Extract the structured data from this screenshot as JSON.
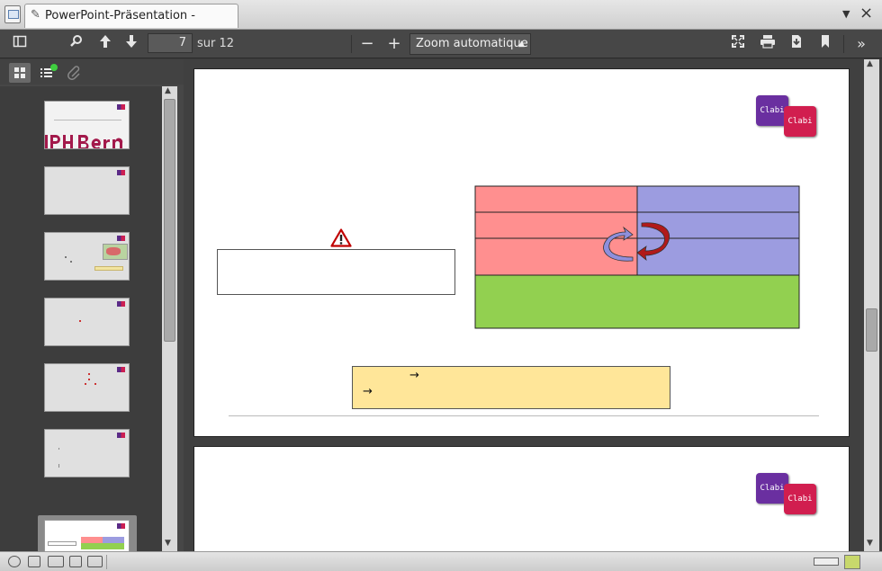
{
  "window": {
    "tab_title": "PowerPoint-Präsentation - test.pdf",
    "tab_icon": "paperclip-icon",
    "close_glyph": "×"
  },
  "toolbar": {
    "current_page": "7",
    "page_total": "sur 12",
    "zoom_value": "Zoom automatique",
    "zoom_out": "−",
    "zoom_in": "+"
  },
  "page7": {
    "logo_top": "Clabi",
    "logo_bottom": "Clabi",
    "arrow_1": "→",
    "arrow_2": "→",
    "colors": {
      "red_cell": "#ff8f8f",
      "blue_cell": "#9c9ce0",
      "green_cell": "#92d050",
      "yellow_box": "#ffe699"
    }
  },
  "page8": {
    "logo_top": "Clabi",
    "logo_bottom": "Clabi"
  }
}
